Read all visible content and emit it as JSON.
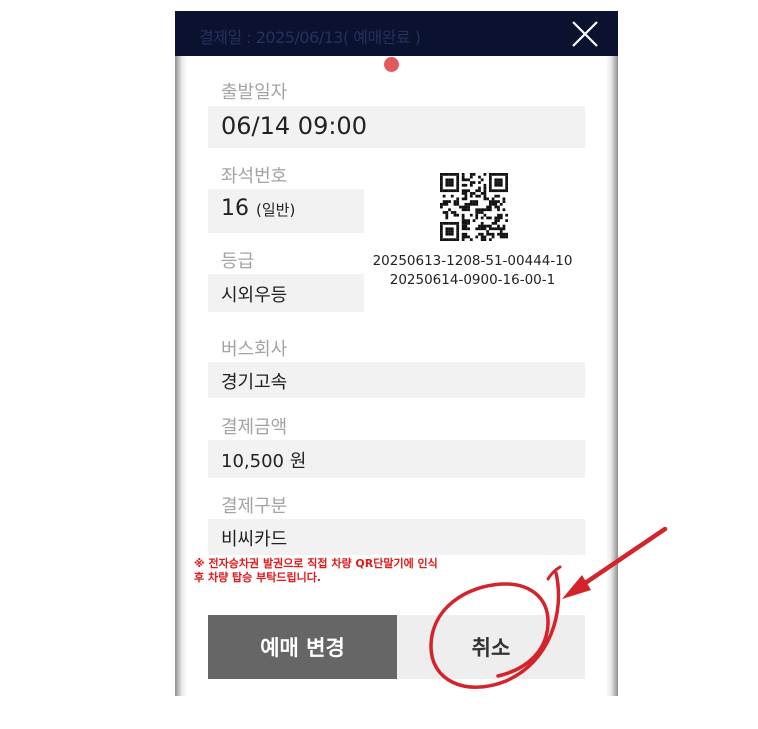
{
  "header": {
    "title": "결제일 : 2025/06/13( 예매완료 )"
  },
  "fields": {
    "departure_date": {
      "label": "출발일자",
      "value": "06/14 09:00"
    },
    "seat": {
      "label": "좌석번호",
      "value": "16",
      "suffix": "(일반)"
    },
    "grade": {
      "label": "등급",
      "value": "시외우등"
    },
    "bus_company": {
      "label": "버스회사",
      "value": "경기고속"
    },
    "amount": {
      "label": "결제금액",
      "value": "10,500 원"
    },
    "payment_type": {
      "label": "결제구분",
      "value": "비씨카드"
    }
  },
  "ticket": {
    "code_1": "20250613-1208-51-00444-10",
    "code_2": "20250614-0900-16-00-1"
  },
  "notice": {
    "line_1": "※ 전자승차권 발권으로 직접 차량 QR단말기에 인식",
    "line_2": "후 차량 탑승 부탁드립니다."
  },
  "buttons": {
    "change": "예매 변경",
    "cancel": "취소"
  },
  "colors": {
    "header_bg": "#0b1230",
    "notice": "#e11919",
    "annotation": "#d4232a",
    "change_button": "#666666"
  }
}
